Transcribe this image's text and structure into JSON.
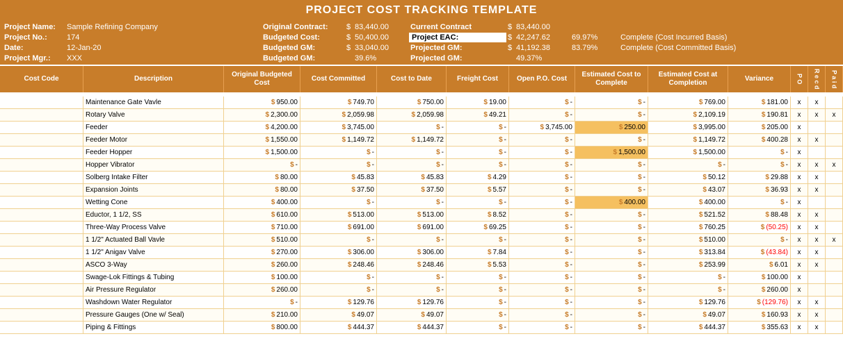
{
  "title": "PROJECT COST TRACKING TEMPLATE",
  "info": {
    "project_name_label": "Project Name:",
    "project_name_value": "Sample Refining Company",
    "project_no_label": "Project No.:",
    "project_no_value": "174",
    "date_label": "Date:",
    "date_value": "12-Jan-20",
    "project_mgr_label": "Project Mgr.:",
    "project_mgr_value": "XXX",
    "orig_contract_label": "Original Contract:",
    "orig_contract_sym": "$",
    "orig_contract_val": "83,440.00",
    "current_contract_label": "Current Contract",
    "current_contract_sym": "$",
    "current_contract_val": "83,440.00",
    "budgeted_cost_label": "Budgeted Cost:",
    "budgeted_cost_sym": "$",
    "budgeted_cost_val": "50,400.00",
    "project_eac_label": "Project EAC:",
    "project_eac_val": "42,247.62",
    "project_eac_sym": "$",
    "pct1": "69.97%",
    "complete1": "Complete (Cost Incurred Basis)",
    "budgeted_gm_label": "Budgeted GM:",
    "budgeted_gm_sym": "$",
    "budgeted_gm_val": "33,040.00",
    "projected_gm_label": "Projected GM:",
    "projected_gm_sym": "$",
    "projected_gm_val": "41,192.38",
    "pct2": "83.79%",
    "complete2": "Complete (Cost Committed Basis)",
    "budgeted_gm2_label": "Budgeted GM:",
    "budgeted_gm2_val": "39.6%",
    "projected_gm2_label": "Projected GM:",
    "projected_gm2_val": "49.37%"
  },
  "headers": {
    "cost_code": "Cost Code",
    "description": "Description",
    "original_budgeted_cost": "Original  Budgeted Cost",
    "cost_committed": "Cost Committed",
    "cost_to_date": "Cost to Date",
    "freight_cost": "Freight Cost",
    "open_po_cost": "Open P.O. Cost",
    "estimated_cost_to_complete": "Estimated Cost to Complete",
    "estimated_cost_at_completion": "Estimated Cost at Completion",
    "variance": "Variance",
    "po": "P O",
    "recd": "R e c d",
    "paid": "P a i d"
  },
  "rows": [
    {
      "desc": "Maintenance Gate Vavle",
      "orig": "950.00",
      "committed": "749.70",
      "todate": "750.00",
      "freight": "19.00",
      "openpo": "-",
      "estcomplete": "-",
      "eac": "769.00",
      "variance": "181.00",
      "po": "x",
      "recd": "x",
      "paid": "",
      "neg_var": false
    },
    {
      "desc": "Rotary Valve",
      "orig": "2,300.00",
      "committed": "2,059.98",
      "todate": "2,059.98",
      "freight": "49.21",
      "openpo": "-",
      "estcomplete": "-",
      "eac": "2,109.19",
      "variance": "190.81",
      "po": "x",
      "recd": "x",
      "paid": "x",
      "neg_var": false
    },
    {
      "desc": "Feeder",
      "orig": "4,200.00",
      "committed": "3,745.00",
      "todate": "-",
      "freight": "-",
      "openpo": "3,745.00",
      "estcomplete": "250.00",
      "eac": "3,995.00",
      "variance": "205.00",
      "po": "x",
      "recd": "",
      "paid": "",
      "neg_var": false
    },
    {
      "desc": "Feeder Motor",
      "orig": "1,550.00",
      "committed": "1,149.72",
      "todate": "1,149.72",
      "freight": "-",
      "openpo": "-",
      "estcomplete": "-",
      "eac": "1,149.72",
      "variance": "400.28",
      "po": "x",
      "recd": "x",
      "paid": "",
      "neg_var": false
    },
    {
      "desc": "Feeder Hopper",
      "orig": "1,500.00",
      "committed": "-",
      "todate": "-",
      "freight": "-",
      "openpo": "-",
      "estcomplete": "1,500.00",
      "eac": "1,500.00",
      "variance": "-",
      "po": "x",
      "recd": "",
      "paid": "",
      "neg_var": false
    },
    {
      "desc": "Hopper Vibrator",
      "orig": "-",
      "committed": "-",
      "todate": "-",
      "freight": "-",
      "openpo": "-",
      "estcomplete": "-",
      "eac": "-",
      "variance": "-",
      "po": "x",
      "recd": "x",
      "paid": "x",
      "neg_var": false
    },
    {
      "desc": "Solberg Intake Filter",
      "orig": "80.00",
      "committed": "45.83",
      "todate": "45.83",
      "freight": "4.29",
      "openpo": "-",
      "estcomplete": "-",
      "eac": "50.12",
      "variance": "29.88",
      "po": "x",
      "recd": "x",
      "paid": "",
      "neg_var": false
    },
    {
      "desc": "Expansion Joints",
      "orig": "80.00",
      "committed": "37.50",
      "todate": "37.50",
      "freight": "5.57",
      "openpo": "-",
      "estcomplete": "-",
      "eac": "43.07",
      "variance": "36.93",
      "po": "x",
      "recd": "x",
      "paid": "",
      "neg_var": false
    },
    {
      "desc": "Wetting Cone",
      "orig": "400.00",
      "committed": "-",
      "todate": "-",
      "freight": "-",
      "openpo": "-",
      "estcomplete": "400.00",
      "eac": "400.00",
      "variance": "-",
      "po": "x",
      "recd": "",
      "paid": "",
      "neg_var": false
    },
    {
      "desc": "Eductor, 1 1/2, SS",
      "orig": "610.00",
      "committed": "513.00",
      "todate": "513.00",
      "freight": "8.52",
      "openpo": "-",
      "estcomplete": "-",
      "eac": "521.52",
      "variance": "88.48",
      "po": "x",
      "recd": "x",
      "paid": "",
      "neg_var": false
    },
    {
      "desc": "Three-Way Process Valve",
      "orig": "710.00",
      "committed": "691.00",
      "todate": "691.00",
      "freight": "69.25",
      "openpo": "-",
      "estcomplete": "-",
      "eac": "760.25",
      "variance": "(50.25)",
      "po": "x",
      "recd": "x",
      "paid": "",
      "neg_var": true
    },
    {
      "desc": "1 1/2\" Actuated Ball Vavle",
      "orig": "510.00",
      "committed": "-",
      "todate": "-",
      "freight": "-",
      "openpo": "-",
      "estcomplete": "-",
      "eac": "510.00",
      "variance": "-",
      "po": "x",
      "recd": "x",
      "paid": "x",
      "neg_var": false
    },
    {
      "desc": "1 1/2\" Anigav Valve",
      "orig": "270.00",
      "committed": "306.00",
      "todate": "306.00",
      "freight": "7.84",
      "openpo": "-",
      "estcomplete": "-",
      "eac": "313.84",
      "variance": "(43.84)",
      "po": "x",
      "recd": "x",
      "paid": "",
      "neg_var": true
    },
    {
      "desc": "ASCO 3-Way",
      "orig": "260.00",
      "committed": "248.46",
      "todate": "248.46",
      "freight": "5.53",
      "openpo": "-",
      "estcomplete": "-",
      "eac": "253.99",
      "variance": "6.01",
      "po": "x",
      "recd": "x",
      "paid": "",
      "neg_var": false
    },
    {
      "desc": "Swage-Lok Fittings & Tubing",
      "orig": "100.00",
      "committed": "-",
      "todate": "-",
      "freight": "-",
      "openpo": "-",
      "estcomplete": "-",
      "eac": "-",
      "variance": "100.00",
      "po": "x",
      "recd": "",
      "paid": "",
      "neg_var": false
    },
    {
      "desc": "Air Pressure Regulator",
      "orig": "260.00",
      "committed": "-",
      "todate": "-",
      "freight": "-",
      "openpo": "-",
      "estcomplete": "-",
      "eac": "-",
      "variance": "260.00",
      "po": "x",
      "recd": "",
      "paid": "",
      "neg_var": false
    },
    {
      "desc": "Washdown Water Regulator",
      "orig": "-",
      "committed": "129.76",
      "todate": "129.76",
      "freight": "-",
      "openpo": "-",
      "estcomplete": "-",
      "eac": "129.76",
      "variance": "(129.76)",
      "po": "x",
      "recd": "x",
      "paid": "",
      "neg_var": true
    },
    {
      "desc": "Pressure Gauges (One w/ Seal)",
      "orig": "210.00",
      "committed": "49.07",
      "todate": "49.07",
      "freight": "-",
      "openpo": "-",
      "estcomplete": "-",
      "eac": "49.07",
      "variance": "160.93",
      "po": "x",
      "recd": "x",
      "paid": "",
      "neg_var": false
    },
    {
      "desc": "Piping & Fittings",
      "orig": "800.00",
      "committed": "444.37",
      "todate": "444.37",
      "freight": "-",
      "openpo": "-",
      "estcomplete": "-",
      "eac": "444.37",
      "variance": "355.63",
      "po": "x",
      "recd": "x",
      "paid": "",
      "neg_var": false
    }
  ]
}
